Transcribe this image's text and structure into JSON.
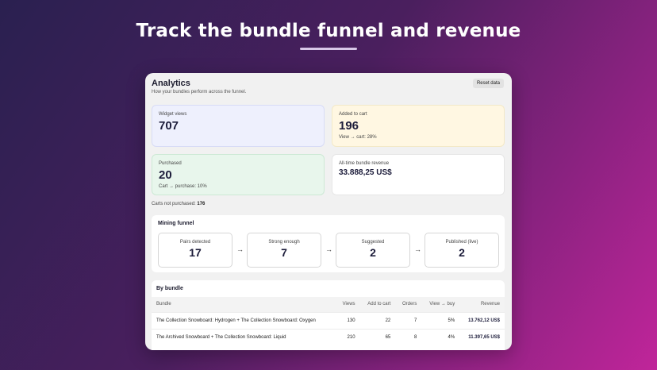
{
  "hero": {
    "title": "Track the bundle funnel and revenue"
  },
  "header": {
    "title": "Analytics",
    "subtitle": "How your bundles perform across the funnel.",
    "reset_label": "Reset data"
  },
  "stats": {
    "views": {
      "label": "Widget views",
      "value": "707"
    },
    "cart": {
      "label": "Added to cart",
      "value": "196",
      "note": "View → cart: 28%"
    },
    "purchased": {
      "label": "Purchased",
      "value": "20",
      "note": "Cart → purchase: 10%"
    },
    "revenue": {
      "label": "All-time bundle revenue",
      "value": "33.888,25 US$"
    }
  },
  "carts_not_purchased": {
    "label": "Carts not purchased:",
    "value": "176"
  },
  "funnel": {
    "title": "Mining funnel",
    "steps": [
      {
        "label": "Pairs detected",
        "value": "17"
      },
      {
        "label": "Strong enough",
        "value": "7"
      },
      {
        "label": "Suggested",
        "value": "2"
      },
      {
        "label": "Published (live)",
        "value": "2"
      }
    ],
    "arrow": "→"
  },
  "bundles": {
    "title": "By bundle",
    "columns": [
      "Bundle",
      "Views",
      "Add to cart",
      "Orders",
      "View → buy",
      "Revenue"
    ],
    "rows": [
      [
        "The Collection Snowboard: Hydrogen + The Collection Snowboard: Oxygen",
        "130",
        "22",
        "7",
        "5%",
        "13.762,12 US$"
      ],
      [
        "The Archived Snowboard + The Collection Snowboard: Liquid",
        "210",
        "65",
        "8",
        "4%",
        "11.397,65 US$"
      ]
    ]
  },
  "colors": {
    "views_card": "#eef0fd",
    "cart_card": "#fff7e2",
    "purchased_card": "#e8f6ec",
    "background_start": "#2a2050",
    "background_end": "#c0259a"
  }
}
